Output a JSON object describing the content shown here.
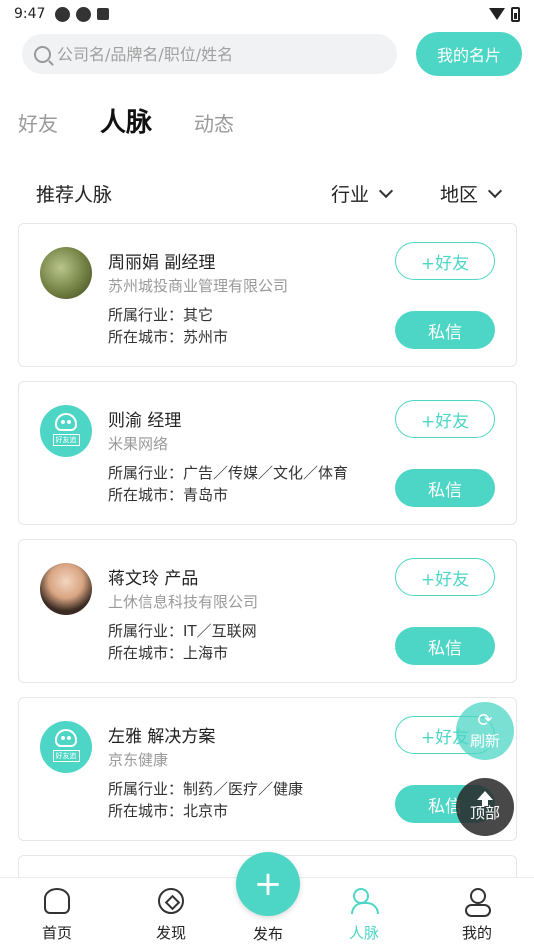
{
  "status_bar": {
    "time": "9:47"
  },
  "search": {
    "placeholder": "公司名/品牌名/职位/姓名",
    "my_card_label": "我的名片"
  },
  "tabs": [
    {
      "label": "好友"
    },
    {
      "label": "人脉"
    },
    {
      "label": "动态"
    }
  ],
  "filter": {
    "title": "推荐人脉",
    "industry_label": "行业",
    "region_label": "地区"
  },
  "cards": [
    {
      "name_title": "周丽娟 副经理",
      "company": "苏州城投商业管理有限公司",
      "industry": "所属行业：其它",
      "city": "所在城市：苏州市",
      "add_label": "+好友",
      "msg_label": "私信",
      "avatar": "photo-green"
    },
    {
      "name_title": "则渝 经理",
      "company": "米果网络",
      "industry": "所属行业：广告／传媒／文化／体育",
      "city": "所在城市：青岛市",
      "add_label": "+好友",
      "msg_label": "私信",
      "avatar": "logo"
    },
    {
      "name_title": "蒋文玲 产品",
      "company": "上休信息科技有限公司",
      "industry": "所属行业：IT／互联网",
      "city": "所在城市：上海市",
      "add_label": "+好友",
      "msg_label": "私信",
      "avatar": "photo"
    },
    {
      "name_title": "左雅 解决方案",
      "company": "京东健康",
      "industry": "所属行业：制药／医疗／健康",
      "city": "所在城市：北京市",
      "add_label": "+好友",
      "msg_label": "私信",
      "avatar": "logo"
    }
  ],
  "float": {
    "refresh_label": "刷新",
    "top_label": "顶部"
  },
  "bottom_nav": {
    "home": "首页",
    "discover": "发现",
    "publish": "发布",
    "people": "人脉",
    "me": "我的"
  },
  "colors": {
    "accent": "#4dd6c5"
  }
}
